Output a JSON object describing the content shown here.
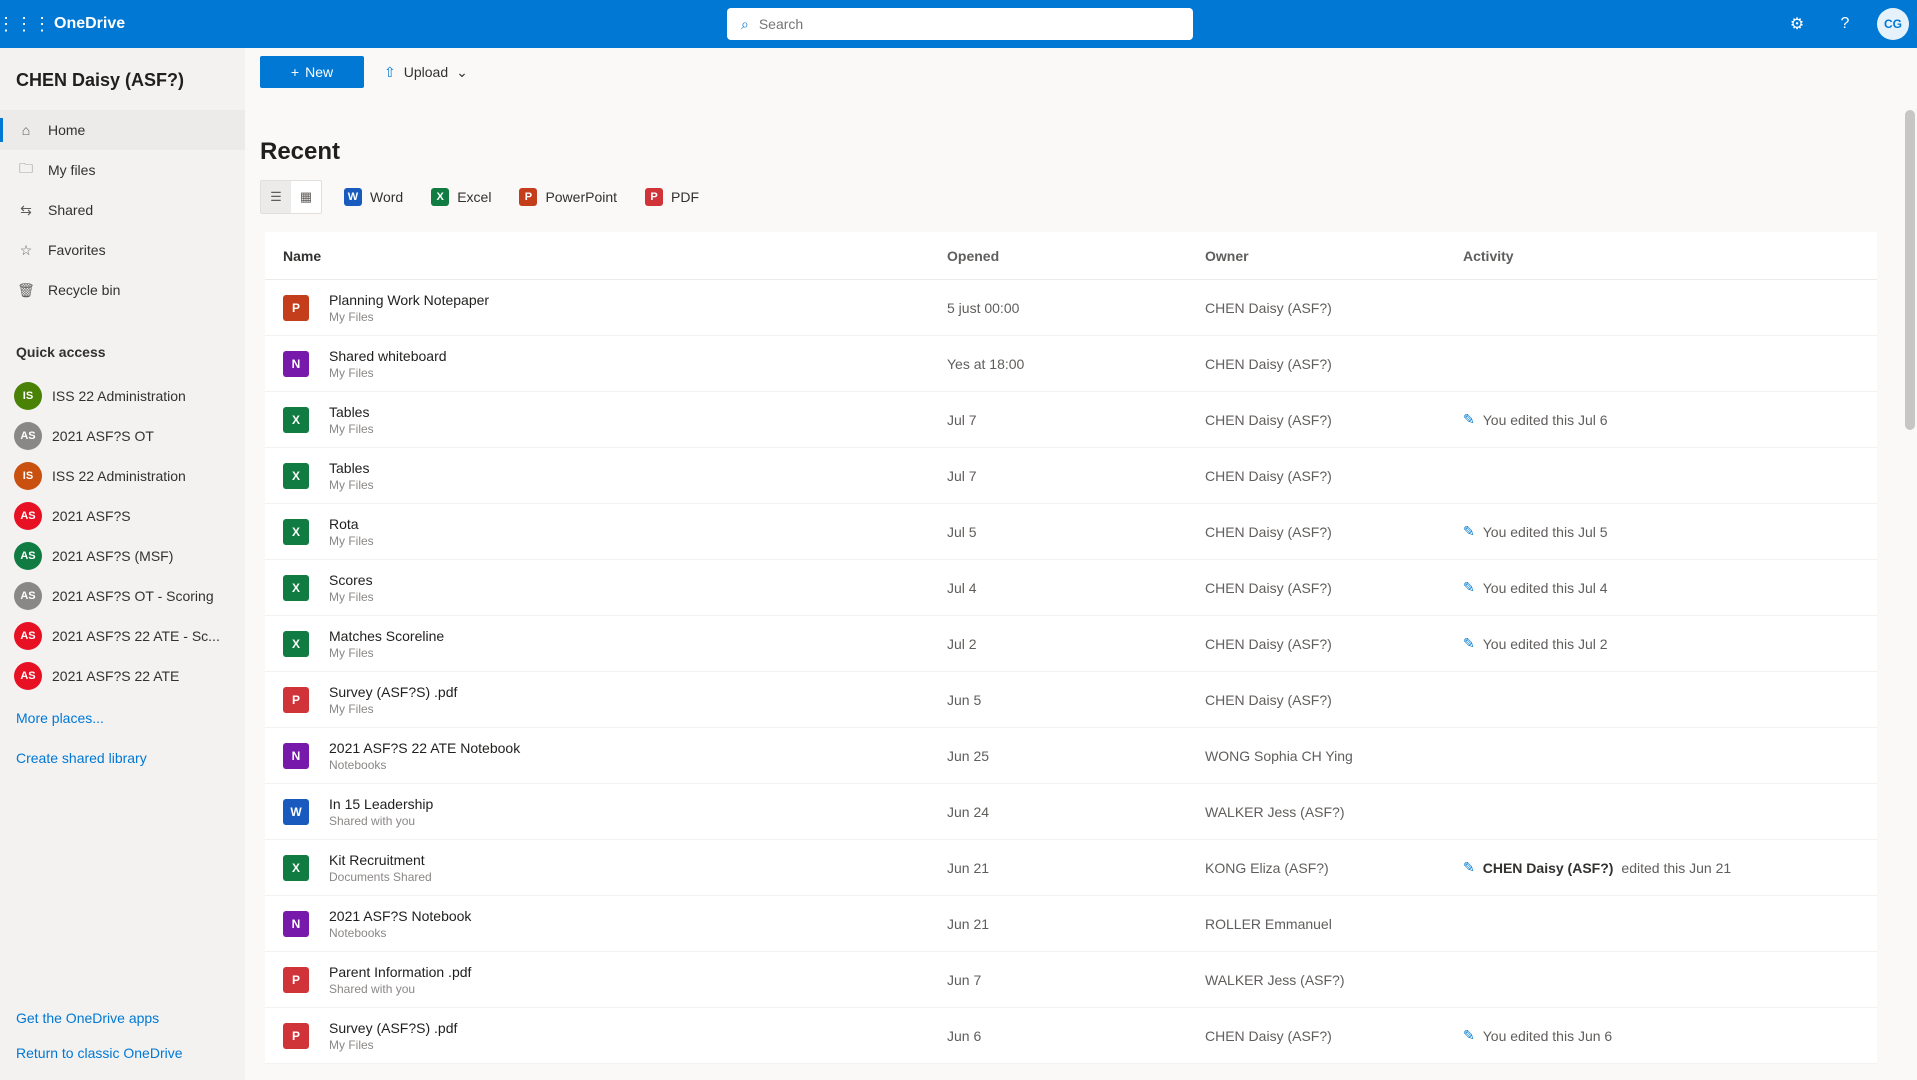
{
  "header": {
    "app_name": "OneDrive",
    "search_placeholder": "Search",
    "avatar_initials": "CG"
  },
  "sidebar": {
    "owner_name": "CHEN Daisy (ASF?)",
    "nav": [
      {
        "label": "Home",
        "icon": "⌂",
        "active": true
      },
      {
        "label": "My files",
        "icon": "🗀",
        "active": false
      },
      {
        "label": "Shared",
        "icon": "⇆",
        "active": false
      },
      {
        "label": "Favorites",
        "icon": "☆",
        "active": false
      },
      {
        "label": "Recycle bin",
        "icon": "🗑",
        "active": false
      }
    ],
    "section_title": "Quick access",
    "libraries": [
      {
        "name": "ISS 22 Administration",
        "initials": "IS",
        "color": "#498205"
      },
      {
        "name": "2021 ASF?S OT",
        "initials": "AS",
        "color": "#8a8886"
      },
      {
        "name": "ISS 22 Administration",
        "initials": "IS",
        "color": "#ca5010"
      },
      {
        "name": "2021 ASF?S",
        "initials": "AS",
        "color": "#e81123"
      },
      {
        "name": "2021 ASF?S (MSF)",
        "initials": "AS",
        "color": "#107c41"
      },
      {
        "name": "2021 ASF?S OT - Scoring",
        "initials": "AS",
        "color": "#8a8886"
      },
      {
        "name": "2021 ASF?S 22 ATE - Sc...",
        "initials": "AS",
        "color": "#e81123"
      },
      {
        "name": "2021 ASF?S 22 ATE",
        "initials": "AS",
        "color": "#e81123"
      }
    ],
    "more_places": "More places...",
    "create_library": "Create shared library",
    "get_apps": "Get the OneDrive apps",
    "return_classic": "Return to classic OneDrive"
  },
  "command_bar": {
    "new_label": "New",
    "upload_label": "Upload"
  },
  "main": {
    "title": "Recent",
    "filters": [
      {
        "label": "Word",
        "letter": "W",
        "color": "#185abd"
      },
      {
        "label": "Excel",
        "letter": "X",
        "color": "#107c41"
      },
      {
        "label": "PowerPoint",
        "letter": "P",
        "color": "#c43e1c"
      },
      {
        "label": "PDF",
        "letter": "P",
        "color": "#d13438"
      }
    ],
    "columns": {
      "name": "Name",
      "opened": "Opened",
      "owner": "Owner",
      "activity": "Activity"
    },
    "files": [
      {
        "name": "Planning Work Notepaper",
        "location": "My Files",
        "type": "ppt",
        "opened": "5 just 00:00",
        "owner": "CHEN Daisy (ASF?)",
        "activity": ""
      },
      {
        "name": "Shared whiteboard",
        "location": "My Files",
        "type": "one",
        "opened": "Yes at 18:00",
        "owner": "CHEN Daisy (ASF?)",
        "activity": ""
      },
      {
        "name": "Tables",
        "location": "My Files",
        "type": "xls",
        "opened": "Jul 7",
        "owner": "CHEN Daisy (ASF?)",
        "activity": "You edited this  Jul 6"
      },
      {
        "name": "Tables",
        "location": "My Files",
        "type": "xls",
        "opened": "Jul 7",
        "owner": "CHEN Daisy (ASF?)",
        "activity": ""
      },
      {
        "name": "Rota",
        "location": "My Files",
        "type": "xls",
        "opened": "Jul 5",
        "owner": "CHEN Daisy (ASF?)",
        "activity": "You edited this  Jul 5"
      },
      {
        "name": "Scores",
        "location": "My Files",
        "type": "xls",
        "opened": "Jul 4",
        "owner": "CHEN Daisy (ASF?)",
        "activity": "You edited this  Jul 4"
      },
      {
        "name": "Matches Scoreline",
        "location": "My Files",
        "type": "xls",
        "opened": "Jul 2",
        "owner": "CHEN Daisy (ASF?)",
        "activity": "You edited this  Jul 2"
      },
      {
        "name": "Survey (ASF?S) .pdf",
        "location": "My Files",
        "type": "pdf",
        "opened": "Jun 5",
        "owner": "CHEN Daisy (ASF?)",
        "activity": ""
      },
      {
        "name": "2021 ASF?S 22 ATE Notebook",
        "location": "Notebooks",
        "type": "one",
        "opened": "Jun 25",
        "owner": "WONG Sophia CH Ying",
        "activity": ""
      },
      {
        "name": "In 15 Leadership",
        "location": "Shared with you",
        "type": "doc",
        "opened": "Jun 24",
        "owner": "WALKER Jess (ASF?)",
        "activity": ""
      },
      {
        "name": "Kit Recruitment",
        "location": "Documents Shared",
        "type": "xls",
        "opened": "Jun 21",
        "owner": "KONG Eliza (ASF?)",
        "activity_bold": "CHEN Daisy (ASF?)",
        "activity": "edited this  Jun 21"
      },
      {
        "name": "2021 ASF?S Notebook",
        "location": "Notebooks",
        "type": "one",
        "opened": "Jun 21",
        "owner": "ROLLER Emmanuel",
        "activity": ""
      },
      {
        "name": "Parent Information .pdf",
        "location": "Shared with you",
        "type": "pdf",
        "opened": "Jun 7",
        "owner": "WALKER Jess (ASF?)",
        "activity": ""
      },
      {
        "name": "Survey (ASF?S) .pdf",
        "location": "My Files",
        "type": "pdf",
        "opened": "Jun 6",
        "owner": "CHEN Daisy (ASF?)",
        "activity": "You edited this  Jun 6"
      }
    ]
  }
}
